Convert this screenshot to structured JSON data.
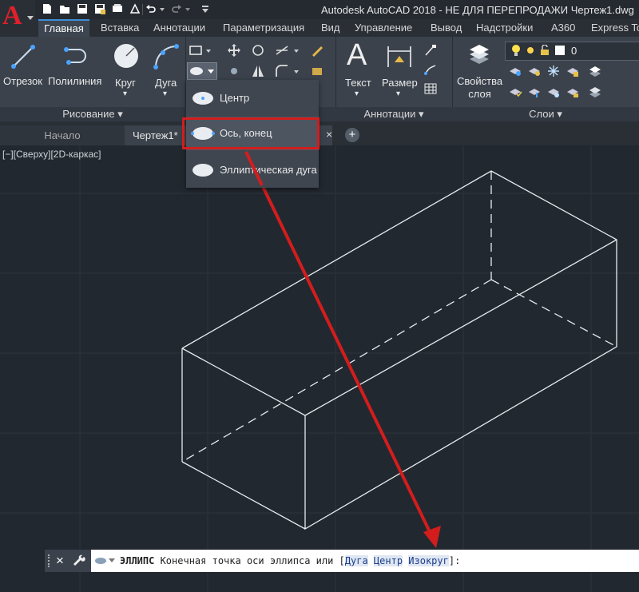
{
  "app": {
    "title": "Autodesk AutoCAD 2018 - НЕ ДЛЯ ПЕРЕПРОДАЖИ    Чертеж1.dwg"
  },
  "ribbon_tabs": [
    {
      "label": "Главная",
      "active": true
    },
    {
      "label": "Вставка"
    },
    {
      "label": "Аннотации"
    },
    {
      "label": "Параметризация"
    },
    {
      "label": "Вид"
    },
    {
      "label": "Управление"
    },
    {
      "label": "Вывод"
    },
    {
      "label": "Надстройки"
    },
    {
      "label": "A360"
    },
    {
      "label": "Express Too"
    }
  ],
  "draw_panel": {
    "title": "Рисование ▾",
    "tools": [
      "Отрезок",
      "Полилиния",
      "Круг",
      "Дуга"
    ],
    "tool_arrows": [
      "▾",
      "▾"
    ]
  },
  "annotation_panel": {
    "title": "Аннотации ▾",
    "tools": [
      "Текст",
      "Размер"
    ],
    "tool_arrows": [
      "▾",
      "▾"
    ]
  },
  "layers_panel": {
    "title": "Слои ▾",
    "properties_label": "Свойства\nслоя",
    "layer_value": "0"
  },
  "ellipse_menu": {
    "items": [
      "Центр",
      "Ось, конец",
      "Эллиптическая дуга"
    ],
    "highlighted": "Ось, конец"
  },
  "doc_tabs": [
    {
      "label": "Начало"
    },
    {
      "label": "Чертеж1*",
      "active": true
    }
  ],
  "doc_tab_close": "×",
  "doc_tab_add": "+",
  "viewport_label": "[−][Сверху][2D-каркас]",
  "command_line": {
    "close_icon": "×",
    "command": "ЭЛЛИПС",
    "prompt": " Конечная точка оси эллипса или [",
    "options": [
      "Дуга",
      "Центр",
      "Изокруг"
    ],
    "suffix": "]:"
  },
  "colors": {
    "annotation_red": "#d31d1d",
    "accent_blue": "#3e8fd8"
  }
}
